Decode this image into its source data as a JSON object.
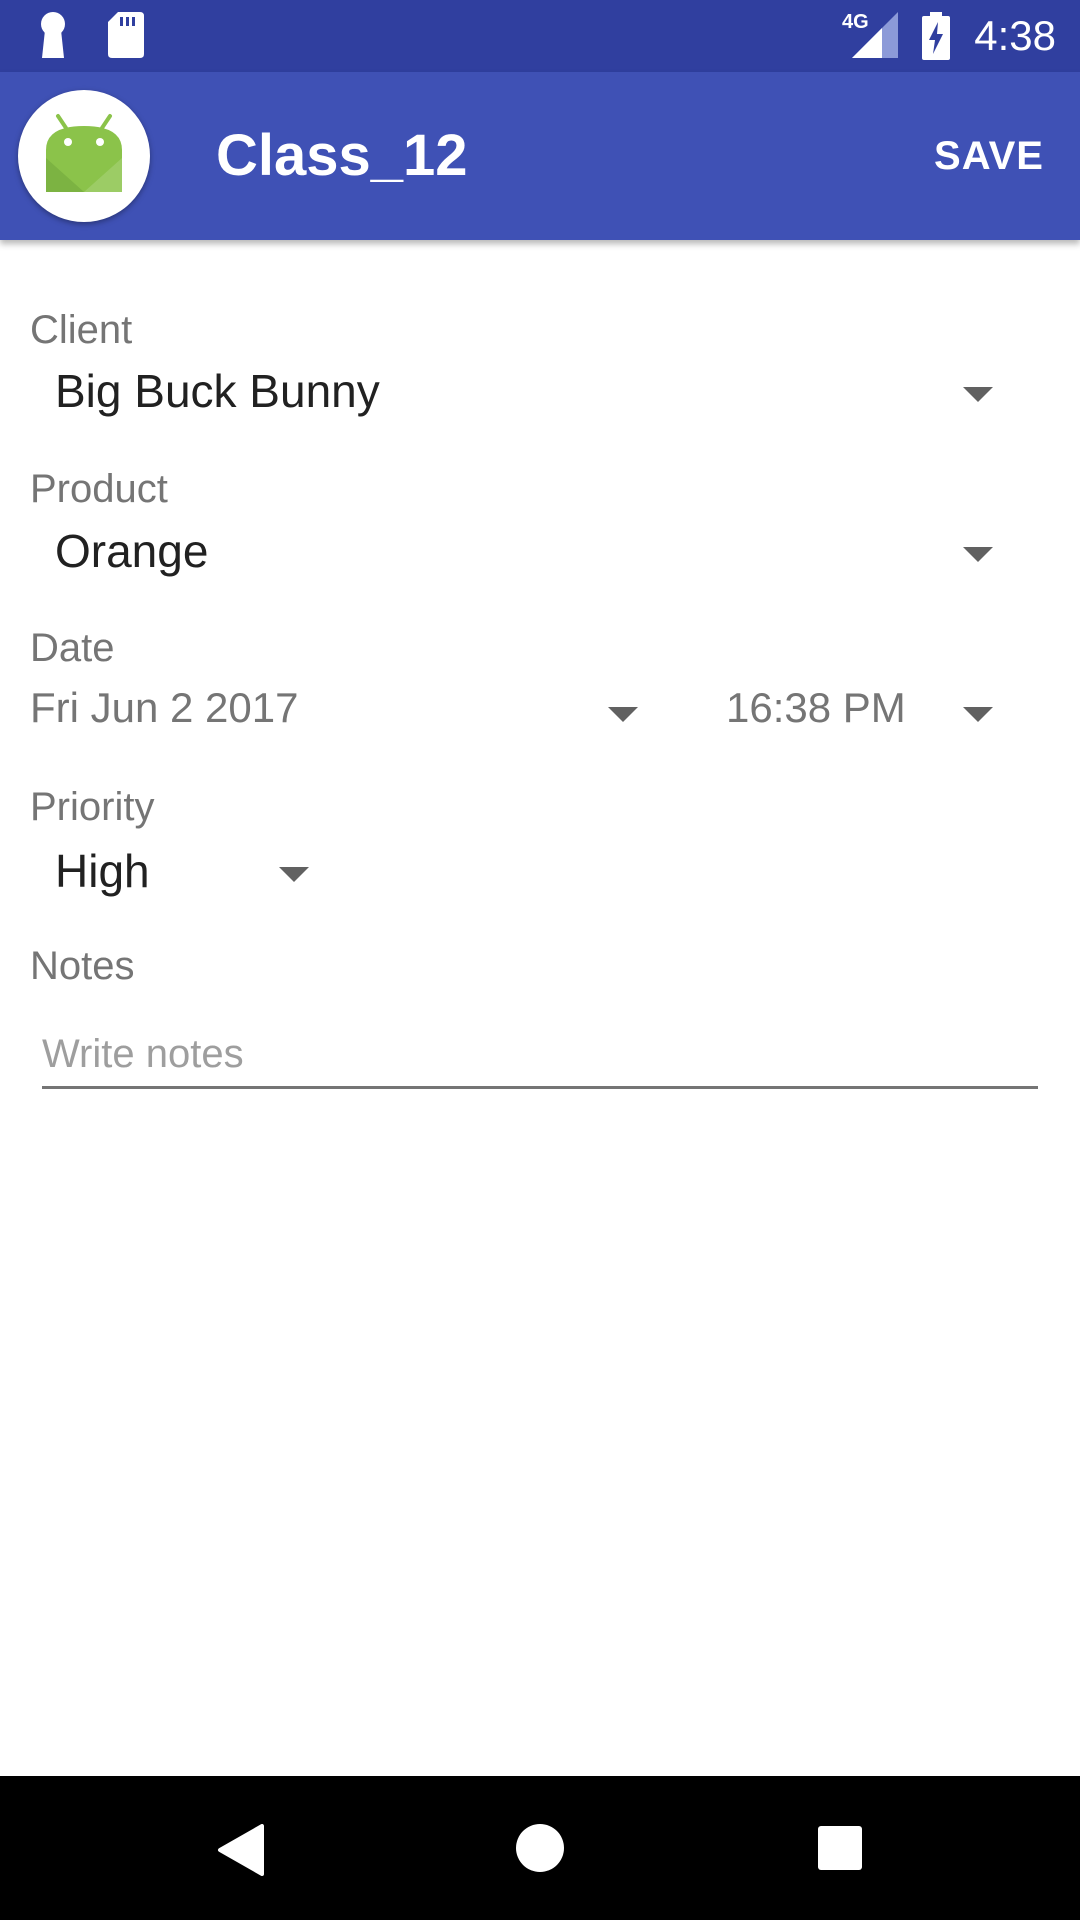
{
  "status_bar": {
    "left_icons": [
      "keyhole-icon",
      "sd-card-icon"
    ],
    "network_label": "4G",
    "right_icons": [
      "cellular-signal-icon",
      "battery-charging-icon"
    ],
    "time": "4:38",
    "background": "#303F9F"
  },
  "app_bar": {
    "icon": "android-icon",
    "title": "Class_12",
    "save_label": "SAVE",
    "background": "#3F51B5"
  },
  "form": {
    "client": {
      "label": "Client",
      "value": "Big Buck Bunny"
    },
    "product": {
      "label": "Product",
      "value": "Orange"
    },
    "date": {
      "label": "Date",
      "date_value": "Fri Jun 2 2017",
      "time_value": "16:38 PM"
    },
    "priority": {
      "label": "Priority",
      "value": "High"
    },
    "notes": {
      "label": "Notes",
      "placeholder": "Write notes",
      "value": ""
    }
  },
  "nav_bar": {
    "buttons": [
      "back-icon",
      "home-icon",
      "recents-icon"
    ]
  }
}
